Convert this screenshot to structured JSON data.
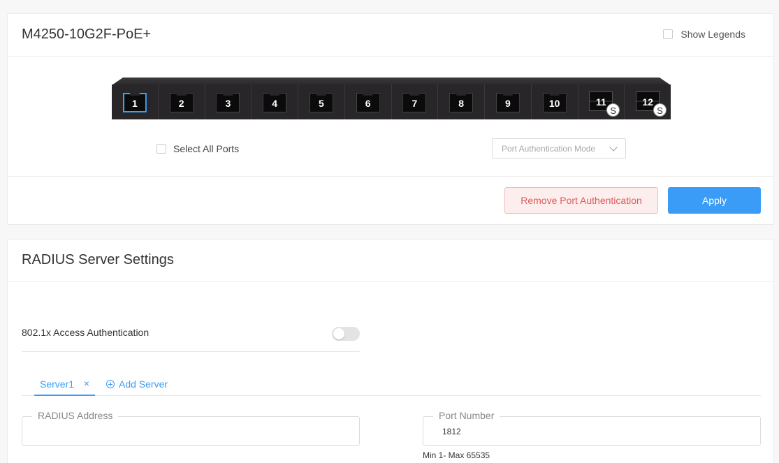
{
  "device_card": {
    "title": "M4250-10G2F-PoE+",
    "show_legends_label": "Show Legends",
    "select_all_label": "Select All Ports",
    "auth_mode_placeholder": "Port Authentication Mode",
    "remove_label": "Remove Port Authentication",
    "apply_label": "Apply",
    "ports": [
      {
        "num": "1",
        "type": "rj45",
        "selected": true
      },
      {
        "num": "2",
        "type": "rj45"
      },
      {
        "num": "3",
        "type": "rj45"
      },
      {
        "num": "4",
        "type": "rj45"
      },
      {
        "num": "5",
        "type": "rj45"
      },
      {
        "num": "6",
        "type": "rj45"
      },
      {
        "num": "7",
        "type": "rj45"
      },
      {
        "num": "8",
        "type": "rj45"
      },
      {
        "num": "9",
        "type": "rj45"
      },
      {
        "num": "10",
        "type": "rj45"
      },
      {
        "num": "11",
        "type": "sfp",
        "badge": "S"
      },
      {
        "num": "12",
        "type": "sfp",
        "badge": "S"
      }
    ]
  },
  "radius_card": {
    "title": "RADIUS Server Settings",
    "access_auth_label": "802.1x Access Authentication",
    "access_auth_enabled": false,
    "tab_server_label": "Server1",
    "tab_close": "×",
    "add_server_label": "Add Server",
    "radius_address_label": "RADIUS Address",
    "radius_address_value": "",
    "port_number_label": "Port Number",
    "port_number_value": "1812",
    "port_hint": "Min 1- Max 65535"
  },
  "colors": {
    "accent": "#3b9cf7",
    "danger_text": "#e05a5a",
    "danger_bg": "#fdeeee"
  }
}
